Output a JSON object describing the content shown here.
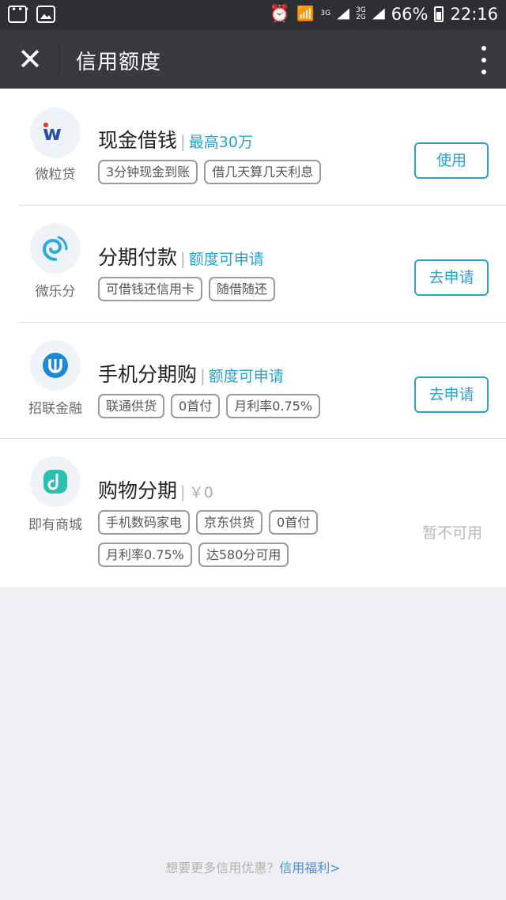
{
  "status_bar": {
    "left_icons": [
      "message-icon",
      "image-icon"
    ],
    "alarm_icon": "alarm-icon",
    "wifi_icon": "wifi-icon",
    "network_top": "3G",
    "network_mid_top": "3G",
    "network_mid_bottom": "2G",
    "battery_percent": "66%",
    "time": "22:16"
  },
  "nav": {
    "close_icon": "close-icon",
    "title": "信用额度",
    "more_icon": "more-vertical-icon"
  },
  "items": [
    {
      "brand": "微粒贷",
      "logo_icon": "weilidai-logo-icon",
      "logo_color": "#e8312f",
      "title": "现金借钱",
      "quota": "最高30万",
      "tags": [
        "3分钟现金到账",
        "借几天算几天利息"
      ],
      "action": "使用"
    },
    {
      "brand": "微乐分",
      "logo_icon": "weilefen-swirl-icon",
      "logo_color": "#2ba9e0",
      "title": "分期付款",
      "quota": "额度可申请",
      "tags": [
        "可借钱还信用卡",
        "随借随还"
      ],
      "action": "去申请"
    },
    {
      "brand": "招联金融",
      "logo_icon": "zhaolian-u-logo-icon",
      "logo_color": "#1e88d4",
      "title": "手机分期购",
      "quota": "额度可申请",
      "tags": [
        "联通供货",
        "0首付",
        "月利率0.75%"
      ],
      "action": "去申请"
    },
    {
      "brand": "即有商城",
      "logo_icon": "jiyou-logo-icon",
      "logo_color": "#2bbfae",
      "title": "购物分期",
      "quota": "￥0",
      "tags": [
        "手机数码家电",
        "京东供货",
        "0首付",
        "月利率0.75%",
        "达580分可用"
      ],
      "action": "暂不可用"
    }
  ],
  "footer": {
    "text": "想要更多信用优惠？",
    "link": "信用福利>"
  },
  "colors": {
    "accent": "#29a3c9",
    "nav_bg": "#393a3f",
    "status_bg": "#2e2f34",
    "page_bg": "#efeff4"
  }
}
